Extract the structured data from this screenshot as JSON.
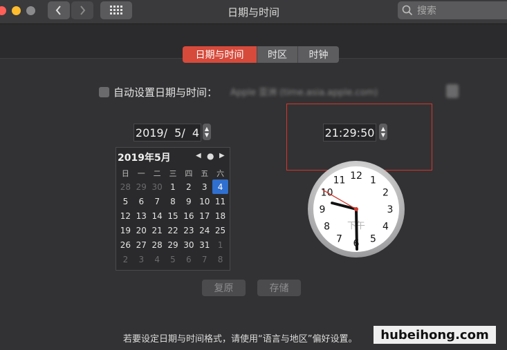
{
  "window": {
    "title": "日期与时间",
    "search_placeholder": "搜索"
  },
  "tabs": [
    {
      "label": "日期与时间",
      "active": true
    },
    {
      "label": "时区",
      "active": false
    },
    {
      "label": "时钟",
      "active": false
    }
  ],
  "auto_set": {
    "label": "自动设置日期与时间：",
    "checked": false,
    "server_value": "Apple 亚洲 (time.asia.apple.com)"
  },
  "date_field": {
    "value": "2019/  5/  4"
  },
  "time_field": {
    "value": "21:29:50"
  },
  "calendar": {
    "month_title": "2019年5月",
    "weekdays": [
      "日",
      "一",
      "二",
      "三",
      "四",
      "五",
      "六"
    ],
    "days": [
      {
        "d": "28",
        "muted": true
      },
      {
        "d": "29",
        "muted": true
      },
      {
        "d": "30",
        "muted": true
      },
      {
        "d": "1"
      },
      {
        "d": "2"
      },
      {
        "d": "3"
      },
      {
        "d": "4",
        "selected": true
      },
      {
        "d": "5"
      },
      {
        "d": "6"
      },
      {
        "d": "7"
      },
      {
        "d": "8"
      },
      {
        "d": "9"
      },
      {
        "d": "10"
      },
      {
        "d": "11"
      },
      {
        "d": "12"
      },
      {
        "d": "13"
      },
      {
        "d": "14"
      },
      {
        "d": "15"
      },
      {
        "d": "16"
      },
      {
        "d": "17"
      },
      {
        "d": "18"
      },
      {
        "d": "19"
      },
      {
        "d": "20"
      },
      {
        "d": "21"
      },
      {
        "d": "22"
      },
      {
        "d": "23"
      },
      {
        "d": "24"
      },
      {
        "d": "25"
      },
      {
        "d": "26"
      },
      {
        "d": "27"
      },
      {
        "d": "28"
      },
      {
        "d": "29"
      },
      {
        "d": "30"
      },
      {
        "d": "31"
      },
      {
        "d": "1",
        "muted": true
      },
      {
        "d": "2",
        "muted": true
      },
      {
        "d": "3",
        "muted": true
      },
      {
        "d": "4",
        "muted": true
      },
      {
        "d": "5",
        "muted": true
      },
      {
        "d": "6",
        "muted": true
      },
      {
        "d": "7",
        "muted": true
      },
      {
        "d": "8",
        "muted": true
      }
    ]
  },
  "clock": {
    "numerals": [
      "12",
      "1",
      "2",
      "3",
      "4",
      "5",
      "6",
      "7",
      "8",
      "9",
      "10",
      "11"
    ],
    "ampm": "下午",
    "time": {
      "h": 21,
      "m": 29,
      "s": 50
    }
  },
  "buttons": {
    "revert": "复原",
    "save": "存储"
  },
  "footer": {
    "hint": "若要设定日期与时间格式，请使用“语言与地区”偏好设置。"
  },
  "watermark": "hubeihong.com",
  "colors": {
    "accent": "#d64a3b",
    "selection": "#2f6fcf",
    "highlight_box": "#d9342b"
  }
}
